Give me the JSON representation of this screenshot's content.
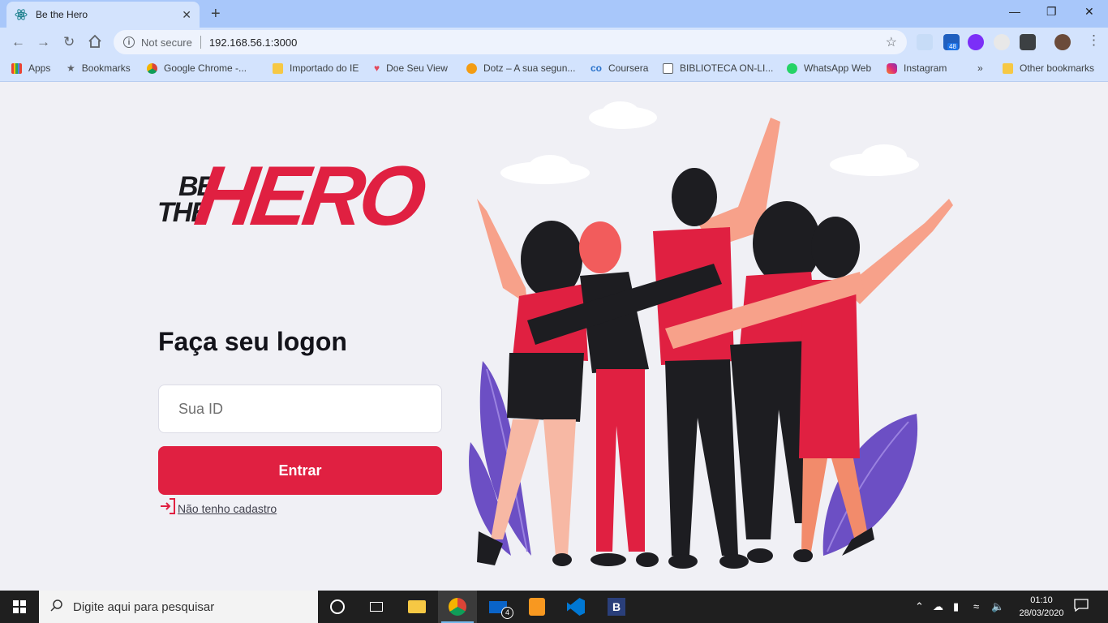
{
  "browser": {
    "tab_title": "Be the Hero",
    "tab_close": "✕",
    "new_tab": "+",
    "security_label": "Not secure",
    "url": "192.168.56.1:3000",
    "extension_badge": "48",
    "window_controls": {
      "minimize": "—",
      "restore": "❐",
      "close": "✕"
    }
  },
  "bookmarks": [
    {
      "label": "Apps",
      "icon": "apps-grid-icon",
      "color": "#4285f4"
    },
    {
      "label": "Bookmarks",
      "icon": "star-icon",
      "color": "#5f6368"
    },
    {
      "label": "Google Chrome -...",
      "icon": "chrome-icon",
      "color": "#db4437"
    },
    {
      "label": "Importado do IE",
      "icon": "folder-icon",
      "color": "#f6c844"
    },
    {
      "label": "Doe Seu View",
      "icon": "heart-icon",
      "color": "#e24a5c"
    },
    {
      "label": "Dotz – A sua segun...",
      "icon": "dotz-icon",
      "color": "#f39c12"
    },
    {
      "label": "Coursera",
      "icon": "coursera-icon",
      "color": "#2a73cc"
    },
    {
      "label": "BIBLIOTECA ON-LI...",
      "icon": "library-icon",
      "color": "#5f6368"
    },
    {
      "label": "WhatsApp Web",
      "icon": "whatsapp-icon",
      "color": "#25d366"
    },
    {
      "label": "Instagram",
      "icon": "instagram-icon",
      "color": "#c13584"
    }
  ],
  "bookmarks_overflow": "»",
  "other_bookmarks": "Other bookmarks",
  "logo": {
    "top_word": "BE",
    "mid_word": "THE",
    "main_word": "HERO"
  },
  "login": {
    "heading": "Faça seu logon",
    "id_placeholder": "Sua ID",
    "submit_label": "Entrar",
    "register_link": "Não tenho cadastro"
  },
  "colors": {
    "brand_red": "#e02041",
    "page_bg": "#f0f0f5",
    "text_dark": "#13131a"
  },
  "taskbar": {
    "search_placeholder": "Digite aqui para pesquisar",
    "mail_badge": "4",
    "time": "01:10",
    "date": "28/03/2020"
  }
}
